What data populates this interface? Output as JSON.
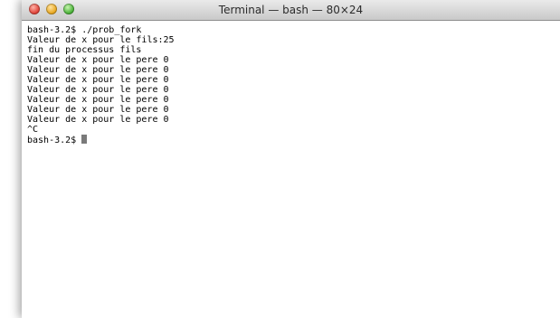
{
  "window": {
    "title": "Terminal — bash — 80×24"
  },
  "terminal": {
    "lines": [
      "bash-3.2$ ./prob_fork",
      "Valeur de x pour le fils:25",
      "fin du processus fils",
      "Valeur de x pour le pere 0",
      "Valeur de x pour le pere 0",
      "Valeur de x pour le pere 0",
      "Valeur de x pour le pere 0",
      "Valeur de x pour le pere 0",
      "Valeur de x pour le pere 0",
      "Valeur de x pour le pere 0",
      "^C"
    ],
    "prompt": "bash-3.2$ "
  }
}
